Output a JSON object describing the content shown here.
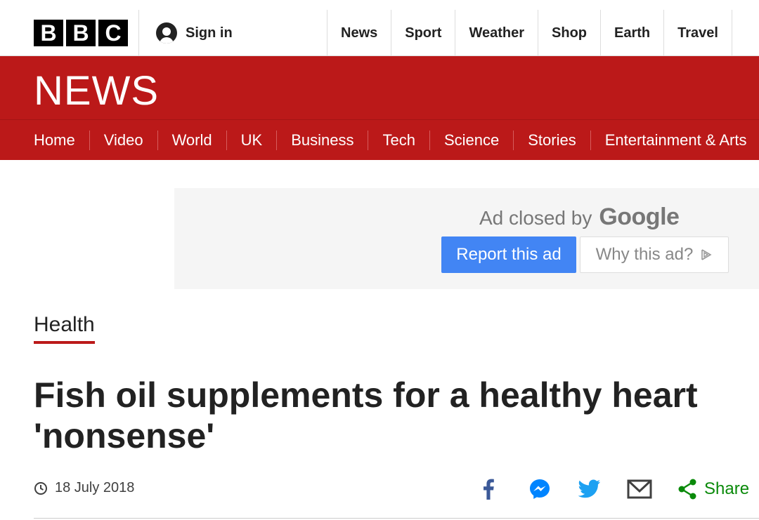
{
  "header": {
    "logo_letters": [
      "B",
      "B",
      "C"
    ],
    "sign_in_label": "Sign in",
    "sign_in_icon": "user-icon",
    "top_nav": [
      {
        "label": "News"
      },
      {
        "label": "Sport"
      },
      {
        "label": "Weather"
      },
      {
        "label": "Shop"
      },
      {
        "label": "Earth"
      },
      {
        "label": "Travel"
      }
    ]
  },
  "banner": {
    "title": "NEWS",
    "background_color": "#bb1919",
    "section_nav": [
      {
        "label": "Home"
      },
      {
        "label": "Video"
      },
      {
        "label": "World"
      },
      {
        "label": "UK"
      },
      {
        "label": "Business"
      },
      {
        "label": "Tech"
      },
      {
        "label": "Science"
      },
      {
        "label": "Stories"
      },
      {
        "label": "Entertainment & Arts"
      }
    ]
  },
  "ad": {
    "closed_text": "Ad closed by",
    "closed_brand": "Google",
    "report_label": "Report this ad",
    "why_label": "Why this ad?",
    "why_icon": "adchoices-play-icon",
    "report_color": "#4285f4"
  },
  "article": {
    "category": "Health",
    "headline": "Fish oil supplements for a healthy heart 'nonsense'",
    "date": "18 July 2018",
    "date_icon": "clock-icon",
    "share": {
      "icons": [
        "facebook-icon",
        "messenger-icon",
        "twitter-icon",
        "email-icon"
      ],
      "share_label": "Share",
      "share_color": "#0a8a0a"
    }
  }
}
